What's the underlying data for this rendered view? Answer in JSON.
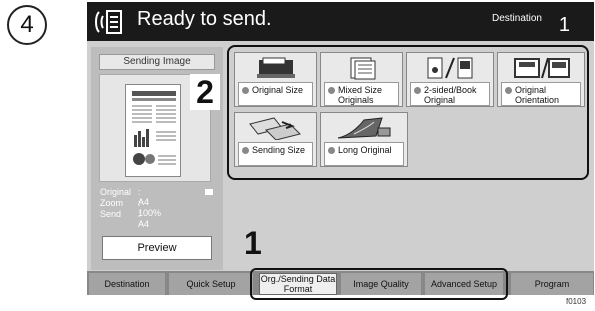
{
  "step": "4",
  "header": {
    "title": "Ready to send.",
    "destination_label": "Destination",
    "destination_count": "1"
  },
  "preview_panel": {
    "sending_image_label": "Sending Image",
    "callout": "2",
    "info": [
      {
        "key": "Original",
        "value": ": A4"
      },
      {
        "key": "Zoom",
        "value": ": 100%"
      },
      {
        "key": "Send",
        "value": ": A4"
      }
    ],
    "preview_button": "Preview"
  },
  "options": {
    "original_size": "Original Size",
    "mixed_size": "Mixed Size Originals",
    "two_sided": "2-sided/Book Original",
    "orientation": "Original Orientation",
    "sending_size": "Sending Size",
    "long_original": "Long Original"
  },
  "callout_1": "1",
  "tabs": {
    "destination": "Destination",
    "quick_setup": "Quick Setup",
    "org_sending": "Org./Sending Data Format",
    "image_quality": "Image Quality",
    "advanced_setup": "Advanced Setup",
    "program": "Program"
  },
  "figure_code": "f0103"
}
